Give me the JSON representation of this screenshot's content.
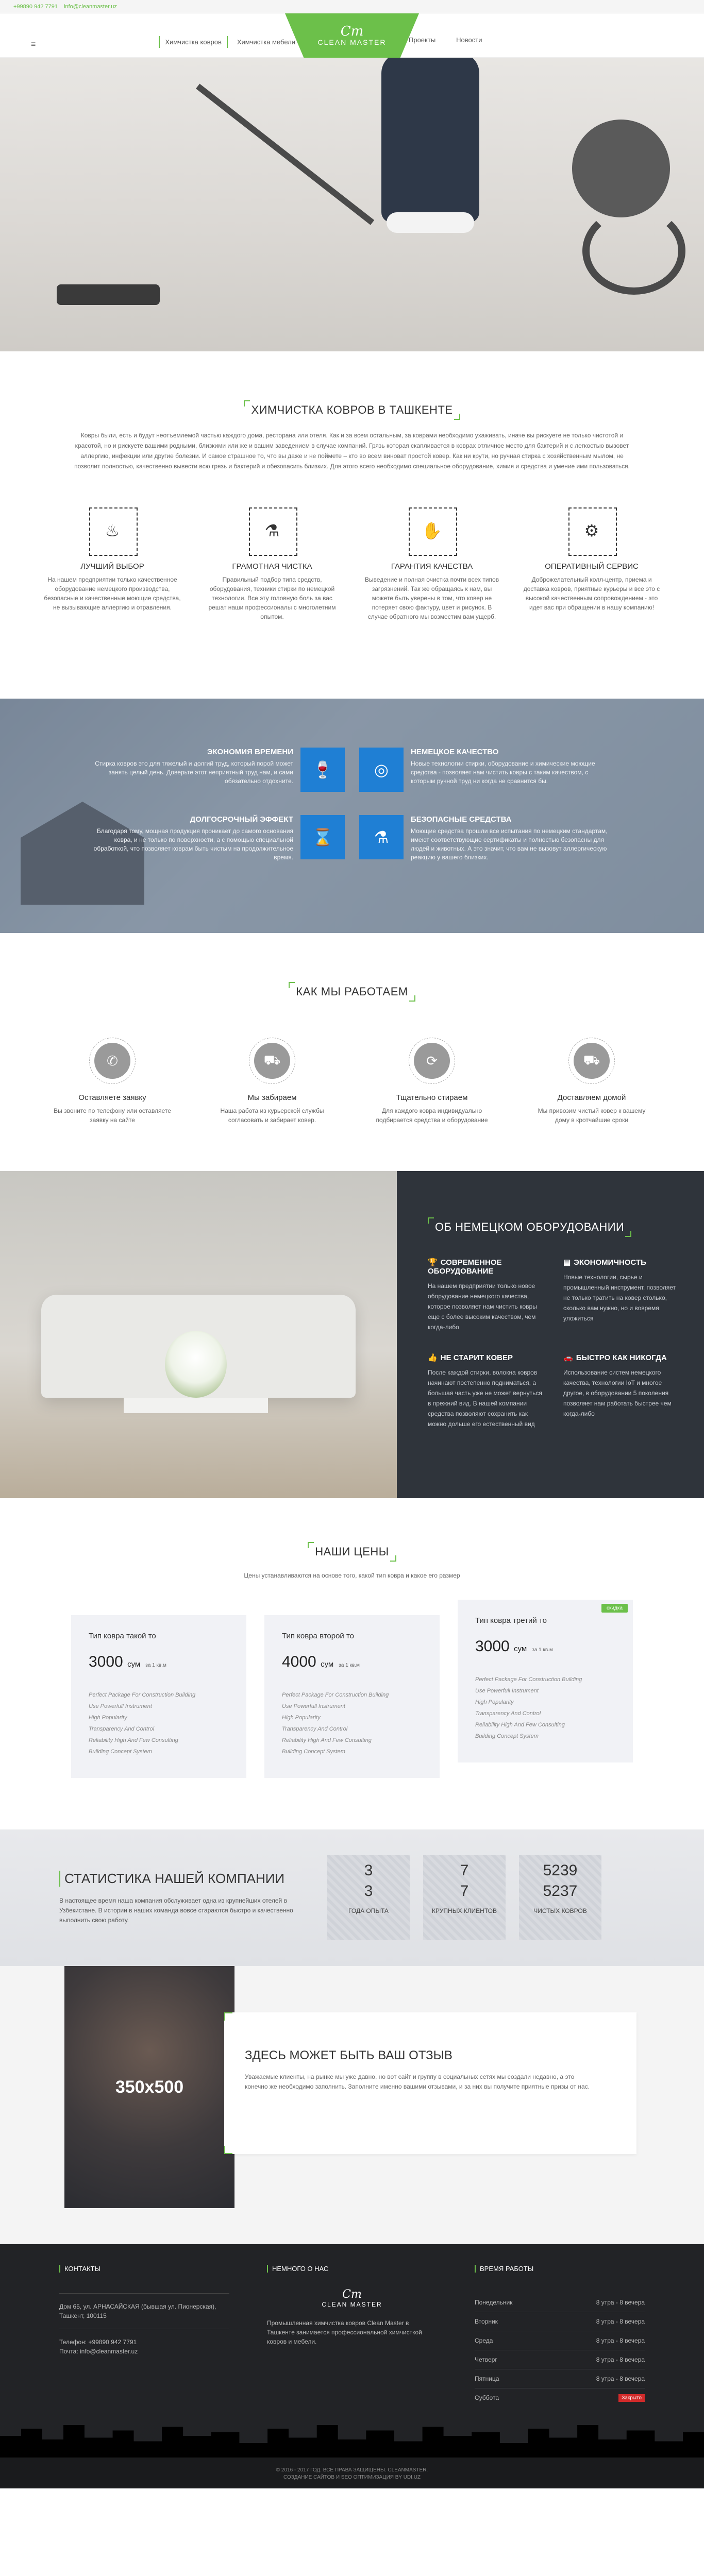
{
  "topbar": {
    "phone": "+99890 942 7791",
    "email": "info@cleanmaster.uz"
  },
  "nav": {
    "left": [
      "Химчистка ковров",
      "Химчистка мебели"
    ],
    "right": [
      "Проекты",
      "Новости"
    ],
    "logo_mark": "Cm",
    "logo_word": "CLEAN MASTER"
  },
  "intro": {
    "title": "Химчистка ковров в Ташкенте",
    "text": "Ковры были, есть и будут неотъемлемой частью каждого дома, ресторана или отеля. Как и за всем остальным, за коврами необходимо ухаживать, иначе вы рискуете не только чистотой и красотой, но и рискуете вашими родными, близкими или же и вашим заведением в случае компаний. Грязь которая скапливается в коврах отличное место для бактерий и с легкостью вызовет аллергию, инфекции или другие болезни. И самое страшное то, что вы даже и не поймете – кто во всем виноват простой ковер. Как ни крути, но ручная стирка с хозяйственным мылом, не позволит полностью, качественно вывести всю грязь и бактерий и обезопасить близких. Для этого всего необходимо специальное оборудование, химия и средства и умение ими пользоваться.",
    "features": [
      {
        "icon": "spray-icon",
        "title": "Лучший выбор",
        "text": "На нашем предприятии только качественное оборудование немецкого производства, безопасные и качественные моющие средства, не вызывающие аллергию и отравления."
      },
      {
        "icon": "flask-icon",
        "title": "Грамотная чистка",
        "text": "Правильный подбор типа средств, оборудования, техники стирки по немецкой технологии. Все эту головную боль за вас решат наши профессионалы с многолетним опытом."
      },
      {
        "icon": "hand-check-icon",
        "title": "Гарантия качества",
        "text": "Выведение и полная очистка почти всех типов загрязнений. Так же обращаясь к нам, вы можете быть уверены в том, что ковер не потеряет свою фактуру, цвет и рисунок. В случае обратного мы возместим вам ущерб."
      },
      {
        "icon": "gear-icon",
        "title": "Оперативный сервис",
        "text": "Доброжелательный колл-центр, приема и доставка ковров, приятные курьеры и все это с высокой качественным сопровождением - это идет вас при обращении в нашу компанию!"
      }
    ]
  },
  "benefits": [
    {
      "side": "left",
      "icon": "glass-icon",
      "title": "Экономия времени",
      "text": "Стирка ковров это для тяжелый и долгий труд, который порой может занять целый день. Доверьте этот неприятный труд нам, и сами обязательно отдохните."
    },
    {
      "side": "right",
      "icon": "aperture-icon",
      "title": "Немецкое качество",
      "text": "Новые технологии стирки, оборудование и химические моющие средства - позволяет нам чистить ковры с таким качеством, с которым ручной труд ни когда не сравнится бы."
    },
    {
      "side": "left",
      "icon": "hourglass-icon",
      "title": "Долгосрочный эффект",
      "text": "Благодаря тому, мощная продукция проникает до самого основания ковра, и не только по поверхности, а с помощью специальной обработкой, что позволяет коврам быть чистым на продолжительное время."
    },
    {
      "side": "right",
      "icon": "flask-icon",
      "title": "Безопасные средства",
      "text": "Моющие средства прошли все испытания по немецким стандартам, имеют соответствующие сертификаты и полностью безопасны для людей и животных. А это значит, что вам не вызовут аллергическую реакцию у вашего близких."
    }
  ],
  "how": {
    "title": "Как мы работаем",
    "steps": [
      {
        "icon": "phone-icon",
        "title": "Оставляете заявку",
        "text": "Вы звоните по телефону или оставляете заявку на сайте"
      },
      {
        "icon": "truck-icon",
        "title": "Мы забираем",
        "text": "Наша работа из курьерской службы согласовать и забирает ковер."
      },
      {
        "icon": "refresh-icon",
        "title": "Тщательно стираем",
        "text": "Для каждого ковра индивидуально подбирается средства и оборудование"
      },
      {
        "icon": "delivery-icon",
        "title": "Доставляем домой",
        "text": "Мы привозим чистый ковер к вашему дому в кротчайшие сроки"
      }
    ]
  },
  "equipment": {
    "title": "Об немецком оборудовании",
    "items": [
      {
        "icon": "trophy-icon",
        "title": "Современное оборудование",
        "text": "На нашем предприятии только новое оборудование немецкого качества, которое позволяет нам чистить ковры еще с более высоким качеством, чем когда-либо"
      },
      {
        "icon": "money-icon",
        "title": "Экономичность",
        "text": "Новые технологии, сырье и промышленный инструмент, позволяет не только тратить на ковер столько, сколько вам нужно, но и вовремя уложиться"
      },
      {
        "icon": "thumb-icon",
        "title": "Не старит ковер",
        "text": "После каждой стирки, волокна ковров начинают постепенно подниматься, а большая часть уже не может вернуться в прежний вид. В нашей компании средства позволяют сохранить как можно дольше его естественный вид"
      },
      {
        "icon": "car-icon",
        "title": "Быстро как никогда",
        "text": "Использование систем немецкого качества, технологии IoT и многое другое, в оборудовании 5 поколения позволяет нам работать быстрее чем когда-либо"
      }
    ]
  },
  "prices": {
    "title": "Наши цены",
    "sub": "Цены устанавливаются на основе того, какой тип ковра и какое его размер",
    "cards": [
      {
        "title": "Тип ковра такой то",
        "price": "3000",
        "currency": "сум",
        "per": "за 1 кв.м",
        "ribbon": "",
        "features": [
          "Perfect Package For Construction Building",
          "Use Powerfull Instrument",
          "High Popularity",
          "Transparency And Control",
          "Reliability High And Few Consulting",
          "Building Concept System"
        ]
      },
      {
        "title": "Тип ковра второй то",
        "price": "4000",
        "currency": "сум",
        "per": "за 1 кв.м",
        "ribbon": "",
        "features": [
          "Perfect Package For Construction Building",
          "Use Powerfull Instrument",
          "High Popularity",
          "Transparency And Control",
          "Reliability High And Few Consulting",
          "Building Concept System"
        ]
      },
      {
        "title": "Тип ковра третий то",
        "price": "3000",
        "currency": "сум",
        "per": "за 1 кв.м",
        "ribbon": "скидка",
        "features": [
          "Perfect Package For Construction Building",
          "Use Powerfull Instrument",
          "High Popularity",
          "Transparency And Control",
          "Reliability High And Few Consulting",
          "Building Concept System"
        ]
      }
    ]
  },
  "stats": {
    "title": "Статистика нашей компании",
    "text": "В настоящее время наша компания обслуживает одна из крупнейших отелей в Узбекистане. В истории в наших команда вовсе стараются быстро и качественно выполнить свою работу.",
    "items": [
      {
        "n1": "3",
        "n2": "3",
        "label": "Года опыта"
      },
      {
        "n1": "7",
        "n2": "7",
        "label": "крупных клиентов"
      },
      {
        "n1": "5239",
        "n2": "5237",
        "label": "чистых ковров"
      }
    ]
  },
  "review": {
    "photo": "350x500",
    "title": "Здесь может быть ваш отзыв",
    "text": "Уважаемые клиенты, на рынке мы уже давно, но вот сайт и группу в социальных сетях мы создали недавно, а это конечно же необходимо заполнить. Заполните именно вашими отзывами, и за них вы получите приятные призы от нас."
  },
  "footer": {
    "contacts_title": "Контакты",
    "address": "Дом 65, ул. АРНАСАЙСКАЯ (бывшая ул. Пионерская), Ташкент, 100115",
    "phone": "Телефон: +99890 942 7791",
    "email": "Почта: info@cleanmaster.uz",
    "about_title": "Немного о нас",
    "about_text": "Промышленная химчистка ковров Clean Master в Ташкенте занимается профессиональной химчисткой ковров и мебели.",
    "hours_title": "Время работы",
    "hours": [
      {
        "day": "Понедельник",
        "time": "8 утра - 8 вечера"
      },
      {
        "day": "Вторник",
        "time": "8 утра - 8 вечера"
      },
      {
        "day": "Среда",
        "time": "8 утра - 8 вечера"
      },
      {
        "day": "Четверг",
        "time": "8 утра - 8 вечера"
      },
      {
        "day": "Пятница",
        "time": "8 утра - 8 вечера"
      },
      {
        "day": "Суббота",
        "time": "Закрыто"
      }
    ],
    "copyright": "© 2016 - 2017 ГОД. ВСЕ ПРАВА ЗАЩИЩЕНЫ. CLEANMASTER.",
    "credit": "СОЗДАНИЕ САЙТОВ И SEO ОПТИМИЗАЦИЯ BY UDI.UZ"
  }
}
